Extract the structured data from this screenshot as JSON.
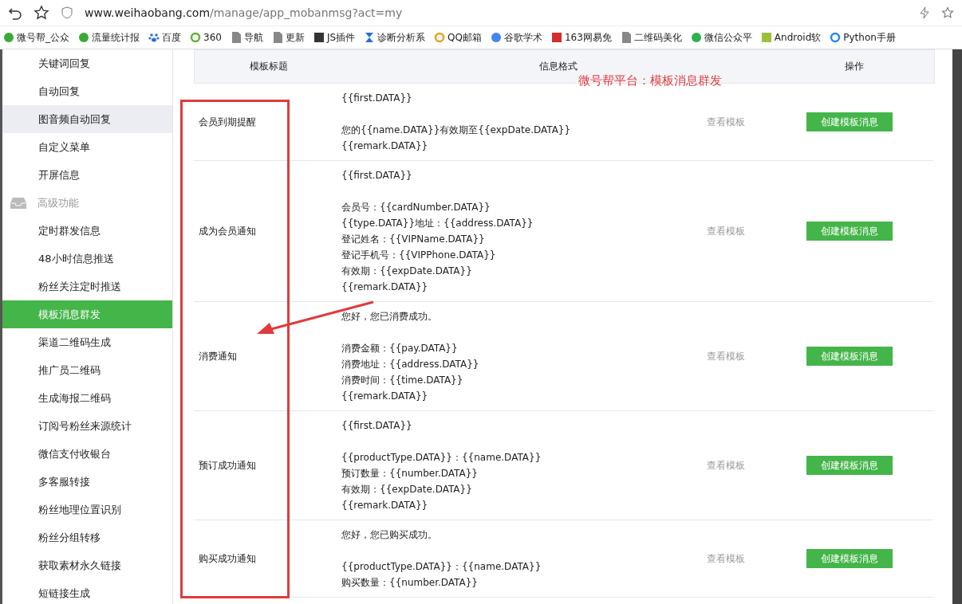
{
  "browser": {
    "url_host": "www.weihaobang.com",
    "url_path": "/manage/app_mobanmsg?act=my"
  },
  "bookmarks": [
    {
      "label": "微号帮_公众",
      "kind": "circle",
      "color": "#3aaa35"
    },
    {
      "label": "流量统计报",
      "kind": "circle",
      "color": "#3aaa35"
    },
    {
      "label": "百度",
      "kind": "paw",
      "color": "#2f6fd6"
    },
    {
      "label": "360",
      "kind": "ring",
      "color": "#5cb531"
    },
    {
      "label": "导航",
      "kind": "page",
      "color": "#888888"
    },
    {
      "label": "更新",
      "kind": "page",
      "color": "#888888"
    },
    {
      "label": "JS插件",
      "kind": "square",
      "color": "#333333"
    },
    {
      "label": "诊断分析系",
      "kind": "hourglass",
      "color": "#2a6fd8"
    },
    {
      "label": "QQ邮箱",
      "kind": "ring",
      "color": "#e8a21c"
    },
    {
      "label": "谷歌学术",
      "kind": "circle",
      "color": "#4285f4"
    },
    {
      "label": "163网易免",
      "kind": "square",
      "color": "#d42d2d"
    },
    {
      "label": "二维码美化",
      "kind": "page",
      "color": "#888888"
    },
    {
      "label": "微信公众平",
      "kind": "circle",
      "color": "#2bb24c"
    },
    {
      "label": "Android软",
      "kind": "square",
      "color": "#9bc13c"
    },
    {
      "label": "Python手册",
      "kind": "ring",
      "color": "#2a8be8"
    }
  ],
  "sidebar": {
    "items": [
      {
        "label": "关键词回复",
        "kind": "item",
        "selected": false,
        "highlighted": false
      },
      {
        "label": "自动回复",
        "kind": "item",
        "selected": false,
        "highlighted": false
      },
      {
        "label": "图音频自动回复",
        "kind": "hovered",
        "selected": false,
        "highlighted": true
      },
      {
        "label": "自定义菜单",
        "kind": "item",
        "selected": false,
        "highlighted": false
      },
      {
        "label": "开屏信息",
        "kind": "item",
        "selected": false,
        "highlighted": false
      },
      {
        "label": "高级功能",
        "kind": "section",
        "selected": false,
        "highlighted": false
      },
      {
        "label": "定时群发信息",
        "kind": "item",
        "selected": false,
        "highlighted": false
      },
      {
        "label": "48小时信息推送",
        "kind": "item",
        "selected": false,
        "highlighted": false
      },
      {
        "label": "粉丝关注定时推送",
        "kind": "item",
        "selected": false,
        "highlighted": false
      },
      {
        "label": "模板消息群发",
        "kind": "item",
        "selected": true,
        "highlighted": false
      },
      {
        "label": "渠道二维码生成",
        "kind": "item",
        "selected": false,
        "highlighted": false
      },
      {
        "label": "推广员二维码",
        "kind": "item",
        "selected": false,
        "highlighted": false
      },
      {
        "label": "生成海报二维码",
        "kind": "item",
        "selected": false,
        "highlighted": false
      },
      {
        "label": "订阅号粉丝来源统计",
        "kind": "item",
        "selected": false,
        "highlighted": false
      },
      {
        "label": "微信支付收银台",
        "kind": "item",
        "selected": false,
        "highlighted": false
      },
      {
        "label": "多客服转接",
        "kind": "item",
        "selected": false,
        "highlighted": false
      },
      {
        "label": "粉丝地理位置识别",
        "kind": "item",
        "selected": false,
        "highlighted": false
      },
      {
        "label": "粉丝分组转移",
        "kind": "item",
        "selected": false,
        "highlighted": false
      },
      {
        "label": "获取素材永久链接",
        "kind": "item",
        "selected": false,
        "highlighted": false
      },
      {
        "label": "短链接生成",
        "kind": "item",
        "selected": false,
        "highlighted": false
      }
    ]
  },
  "table": {
    "columns": [
      "模板标题",
      "信息格式",
      "操作"
    ],
    "rows": [
      {
        "title": "会员到期提醒",
        "format": [
          [
            "{{first.DATA}}"
          ],
          [
            "您的{{name.DATA}}有效期至{{expDate.DATA}}",
            "{{remark.DATA}}"
          ]
        ],
        "view": "查看模板",
        "action": "创建模板消息"
      },
      {
        "title": "成为会员通知",
        "format": [
          [
            "{{first.DATA}}"
          ],
          [
            "会员号：{{cardNumber.DATA}}",
            "{{type.DATA}}地址：{{address.DATA}}",
            "登记姓名：{{VIPName.DATA}}",
            "登记手机号：{{VIPPhone.DATA}}",
            "有效期：{{expDate.DATA}}",
            "{{remark.DATA}}"
          ]
        ],
        "view": "查看模板",
        "action": "创建模板消息"
      },
      {
        "title": "消费通知",
        "format": [
          [
            "您好，您已消费成功。"
          ],
          [
            "消费金额：{{pay.DATA}}",
            "消费地址：{{address.DATA}}",
            "消费时间：{{time.DATA}}",
            "{{remark.DATA}}"
          ]
        ],
        "view": "查看模板",
        "action": "创建模板消息"
      },
      {
        "title": "预订成功通知",
        "format": [
          [
            "{{first.DATA}}"
          ],
          [
            "{{productType.DATA}}：{{name.DATA}}",
            "预订数量：{{number.DATA}}",
            "有效期：{{expDate.DATA}}",
            "{{remark.DATA}}"
          ]
        ],
        "view": "查看模板",
        "action": "创建模板消息"
      },
      {
        "title": "购买成功通知",
        "format": [
          [
            "您好，您已购买成功。"
          ],
          [
            "{{productType.DATA}}：{{name.DATA}}",
            "购买数量：{{number.DATA}}"
          ]
        ],
        "view": "查看模板",
        "action": "创建模板消息"
      }
    ]
  },
  "annotation": {
    "caption": "微号帮平台：模板消息群发"
  }
}
